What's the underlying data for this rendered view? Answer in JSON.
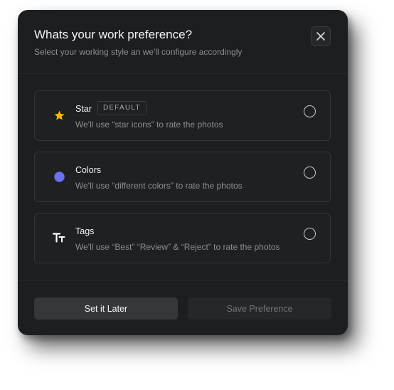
{
  "dialog": {
    "title": "Whats your work preference?",
    "subtitle": "Select your working style an we'll configure accordingly",
    "close_icon": "close-icon"
  },
  "options": [
    {
      "id": "star",
      "icon": "star-icon",
      "icon_color": "#f5b400",
      "title": "Star",
      "badge": "DEFAULT",
      "description": "We'll use “star icons” to rate the photos",
      "selected": false
    },
    {
      "id": "colors",
      "icon": "color-dot-icon",
      "icon_color": "#6b6ff2",
      "title": "Colors",
      "description": "We'll use “different colors” to rate the photos",
      "selected": false
    },
    {
      "id": "tags",
      "icon": "text-tag-icon",
      "icon_color": "#ffffff",
      "title": "Tags",
      "description": "We'll use “Best” “Review” & “Reject” to rate the photos",
      "selected": false
    }
  ],
  "footer": {
    "later_label": "Set it Later",
    "save_label": "Save Preference",
    "save_disabled": true
  },
  "colors": {
    "background": "#1d1e20",
    "border": "#34353a",
    "accent_star": "#f5b400",
    "accent_colors": "#6b6ff2"
  }
}
